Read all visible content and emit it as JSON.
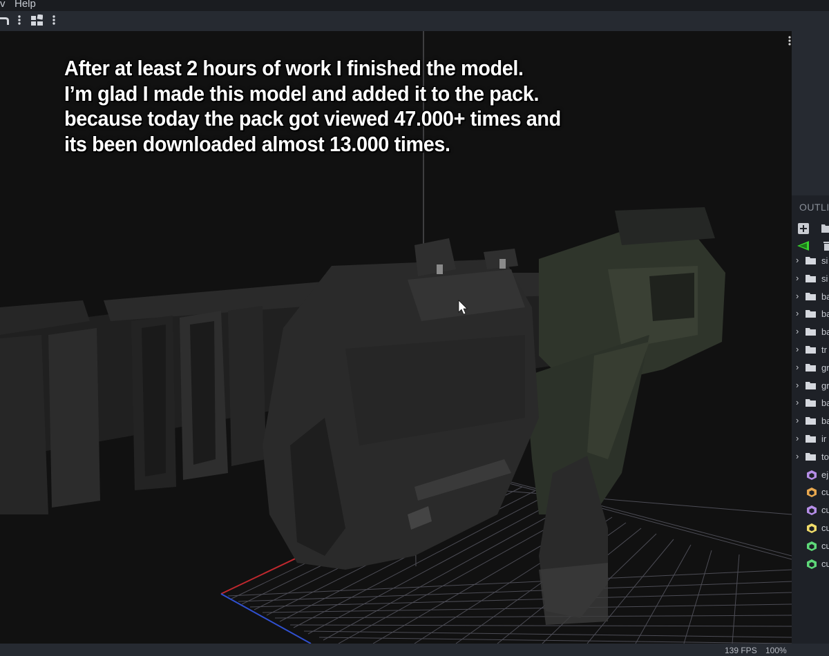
{
  "menubar": {
    "view_fragment": "v",
    "help": "Help"
  },
  "caption": {
    "lines": [
      "After at least 2 hours of work I finished the model.",
      "I’m glad I made this model and added it to the pack.",
      "because today the pack got viewed 47.000+ times and",
      "its been downloaded almost 13.000 times."
    ]
  },
  "outliner": {
    "title": "OUTLI",
    "items": [
      {
        "kind": "group",
        "label": "si"
      },
      {
        "kind": "group",
        "label": "si"
      },
      {
        "kind": "group",
        "label": "ba"
      },
      {
        "kind": "group",
        "label": "ba"
      },
      {
        "kind": "group",
        "label": "ba"
      },
      {
        "kind": "group",
        "label": "tr"
      },
      {
        "kind": "group",
        "label": "gr"
      },
      {
        "kind": "group",
        "label": "gr"
      },
      {
        "kind": "group",
        "label": "ba"
      },
      {
        "kind": "group",
        "label": "ba"
      },
      {
        "kind": "group",
        "label": "ir"
      },
      {
        "kind": "group",
        "label": "to"
      },
      {
        "kind": "cube",
        "label": "ej",
        "color": "#b68ee8"
      },
      {
        "kind": "cube",
        "label": "cu",
        "color": "#e9a84f"
      },
      {
        "kind": "cube",
        "label": "cu",
        "color": "#b68ee8"
      },
      {
        "kind": "cube",
        "label": "cu",
        "color": "#f1dc6a"
      },
      {
        "kind": "cube",
        "label": "cu",
        "color": "#5ed979"
      },
      {
        "kind": "cube",
        "label": "cu",
        "color": "#5ed979"
      }
    ]
  },
  "status": {
    "fps": "139 FPS",
    "zoom": "100%"
  },
  "colors": {
    "accent_green": "#39d42f",
    "axis_red": "#c0282e",
    "axis_blue": "#3050d0"
  }
}
